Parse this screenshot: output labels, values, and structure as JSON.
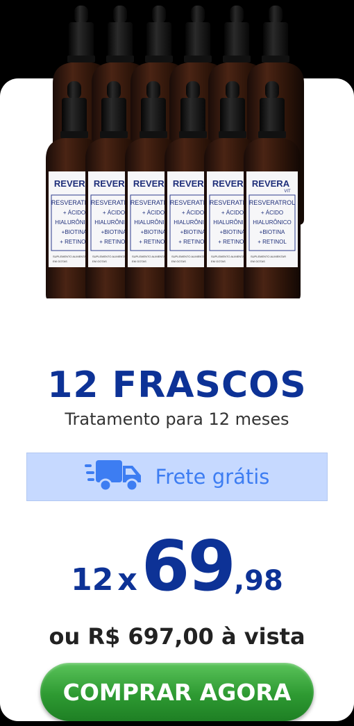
{
  "product": {
    "brand": "REVERA",
    "brand_suffix": "VIT",
    "label_lines": [
      "RESVERATROL",
      "+ ÁCIDO",
      "HIALURÔNICO",
      "+BIOTINA",
      "+ RETINOL"
    ],
    "footer_text": "SUPLEMENTO ALIMENTAR",
    "footer_text2": "EM GOTAS"
  },
  "offer": {
    "title": "12 FRASCOS",
    "subtitle": "Tratamento para 12 meses",
    "shipping_label": "Frete grátis",
    "installment_count": "12",
    "installment_sep": "x",
    "installment_int": "69",
    "installment_cents": ",98",
    "cash_price": "ou R$ 697,00 à vista",
    "buy_label": "COMPRAR AGORA"
  },
  "colors": {
    "title": "#0d3296",
    "shipping_bg": "#c6d9ff",
    "shipping_text": "#3d7df2",
    "button": "#2e9a32"
  },
  "icons": {
    "shipping": "delivery-truck-icon"
  }
}
